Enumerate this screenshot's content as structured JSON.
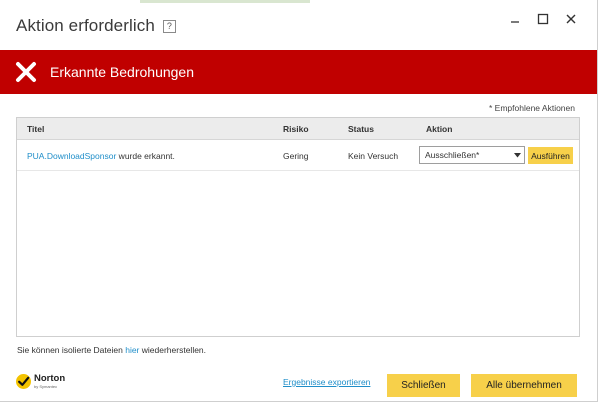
{
  "window": {
    "title": "Aktion erforderlich",
    "help_glyph": "?"
  },
  "banner": {
    "title": "Erkannte Bedrohungen",
    "color": "#c00000"
  },
  "note": "* Empfohlene Aktionen",
  "table": {
    "headers": {
      "title": "Titel",
      "risk": "Risiko",
      "status": "Status",
      "action": "Aktion"
    },
    "rows": [
      {
        "threat_name": "PUA.DownloadSponsor",
        "threat_suffix": " wurde erkannt.",
        "risk": "Gering",
        "status": "Kein Versuch",
        "action_selected": "Ausschließen*",
        "run_label": "Ausführen"
      }
    ]
  },
  "restore": {
    "prefix": "Sie können isolierte Dateien ",
    "link": "hier",
    "suffix": " wiederherstellen."
  },
  "branding": {
    "name": "Norton",
    "sub": "by Symantec"
  },
  "footer": {
    "export_link": "Ergebnisse exportieren",
    "close_label": "Schließen",
    "apply_label": "Alle übernehmen"
  },
  "colors": {
    "accent_yellow": "#f7d04a",
    "link_blue": "#1f8ec9"
  }
}
